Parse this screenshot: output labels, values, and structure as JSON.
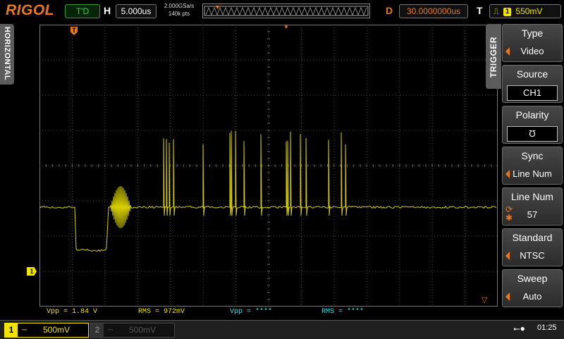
{
  "topbar": {
    "logo": "RIGOL",
    "run_state": "T'D",
    "horizontal_letter": "H",
    "timebase": "5.000us",
    "sample_rate": "2.000GSa/s",
    "memory_depth": "140k pts",
    "delay_letter": "D",
    "delay": "30.0000000us",
    "trigger_letter": "T",
    "trigger_channel": "1",
    "trigger_level": "550mV"
  },
  "left_tab": {
    "label": "HORIZONTAL"
  },
  "trigger_menu": {
    "tab_label": "TRIGGER",
    "items": [
      {
        "title": "Type",
        "value": "Video"
      },
      {
        "title": "Source",
        "value": "CH1"
      },
      {
        "title": "Polarity",
        "value": "Ʊ"
      },
      {
        "title": "Sync",
        "value": "Line Num"
      },
      {
        "title": "Line Num",
        "value": "57"
      },
      {
        "title": "Standard",
        "value": "NTSC"
      },
      {
        "title": "Sweep",
        "value": "Auto"
      }
    ]
  },
  "screen": {
    "ch1_marker": "1",
    "trace_color": "#d8d000",
    "grid_color": "#4a4a4a",
    "trigger_marker_color": "#e8781e"
  },
  "measurements": [
    {
      "text": "Vpp = 1.84 V",
      "color": "#f2e200"
    },
    {
      "text": "RMS = 972mV",
      "color": "#f2e200"
    },
    {
      "text": "Vpp = ****",
      "color": "#2ee6f2"
    },
    {
      "text": "RMS = ****",
      "color": "#2ee6f2"
    }
  ],
  "bottombar": {
    "ch1": {
      "num": "1",
      "coupling": "⎓",
      "scale": "500mV"
    },
    "ch2": {
      "num": "2",
      "coupling": "⎓",
      "scale": "500mV"
    },
    "usb_icon": "usb-icon",
    "time": "01:25"
  }
}
